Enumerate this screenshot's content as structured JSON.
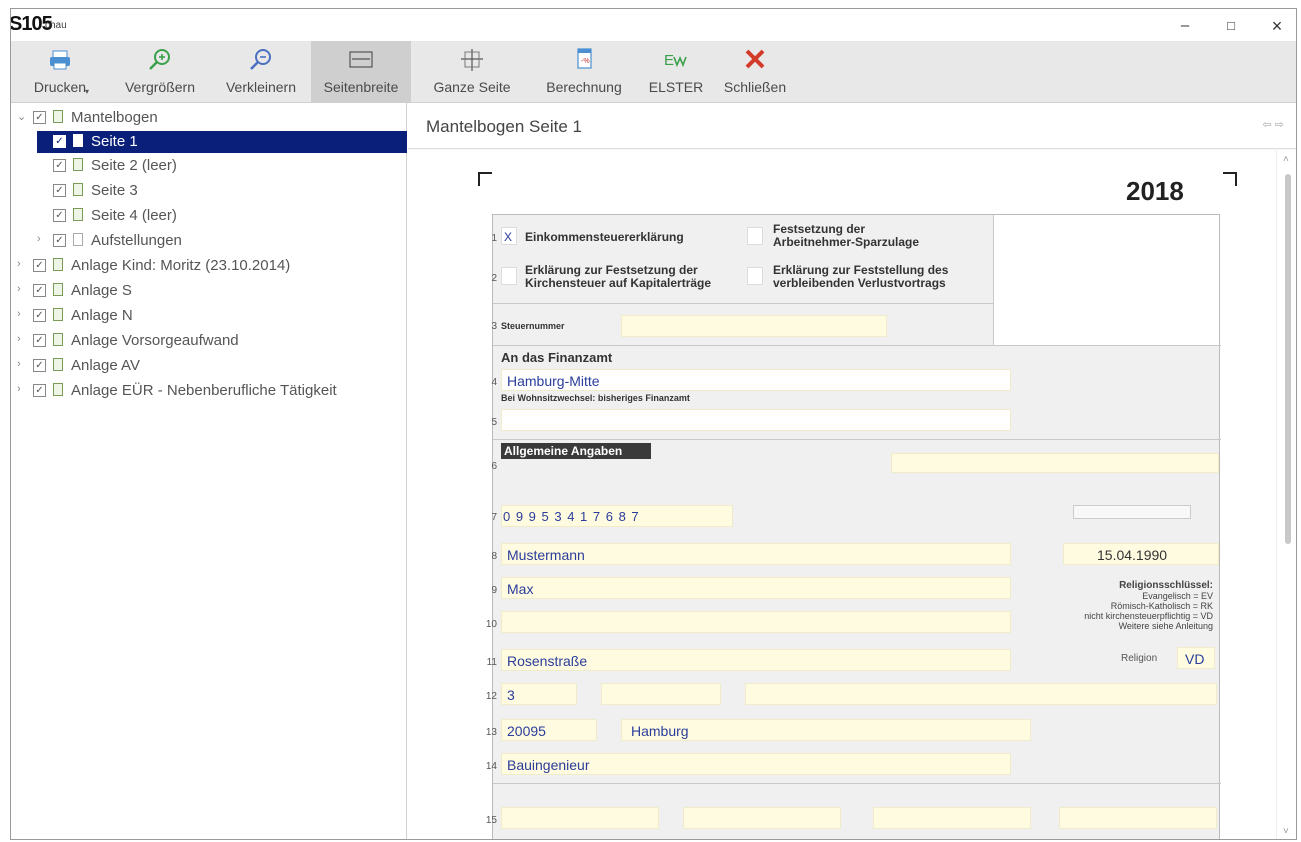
{
  "window": {
    "badge": "S105",
    "title": "chau",
    "minimize": "–",
    "maximize": "□",
    "close": "×"
  },
  "toolbar": {
    "items": [
      {
        "label": "Drucken",
        "icon": "printer-icon"
      },
      {
        "label": "Vergrößern",
        "icon": "zoom-in-icon"
      },
      {
        "label": "Verkleinern",
        "icon": "zoom-out-icon"
      },
      {
        "label": "Seitenbreite",
        "icon": "page-width-icon"
      },
      {
        "label": "Ganze Seite",
        "icon": "whole-page-icon"
      },
      {
        "label": "Berechnung",
        "icon": "calculation-icon"
      },
      {
        "label": "ELSTER",
        "icon": "elster-icon"
      },
      {
        "label": "Schließen",
        "icon": "close-x-icon"
      }
    ],
    "active": "Seitenbreite"
  },
  "tree": {
    "items": [
      {
        "label": "Mantelbogen",
        "expanded": true,
        "level": 0
      },
      {
        "label": "Seite 1",
        "selected": true,
        "level": 1
      },
      {
        "label": "Seite 2 (leer)",
        "level": 1
      },
      {
        "label": "Seite 3",
        "level": 1
      },
      {
        "label": "Seite 4 (leer)",
        "level": 1
      },
      {
        "label": "Aufstellungen",
        "level": 1
      },
      {
        "label": "Anlage Kind: Moritz (23.10.2014)",
        "level": 0
      },
      {
        "label": "Anlage S",
        "level": 0
      },
      {
        "label": "Anlage N",
        "level": 0
      },
      {
        "label": "Anlage Vorsorgeaufwand",
        "level": 0
      },
      {
        "label": "Anlage AV",
        "level": 0
      },
      {
        "label": "Anlage EÜR - Nebenberufliche Tätigkeit",
        "level": 0
      }
    ]
  },
  "main": {
    "title": "Mantelbogen Seite 1",
    "nav_arrows": "⇦ ⇨"
  },
  "form": {
    "year": "2018",
    "line1_check": "X",
    "opt_einkommen": "Einkommensteuererklärung",
    "opt_festsetzung_1": "Festsetzung der",
    "opt_festsetzung_2": "Arbeitnehmer-Sparzulage",
    "opt_kirche_1": "Erklärung zur Festsetzung der",
    "opt_kirche_2": "Kirchensteuer auf Kapitalerträge",
    "opt_verlust_1": "Erklärung zur Feststellung des",
    "opt_verlust_2": "verbleibenden Verlustvortrags",
    "steuernummer_label": "Steuernummer",
    "finanzamt_heading": "An das Finanzamt",
    "finanzamt_value": "Hamburg-Mitte",
    "wohnsitz_label": "Bei Wohnsitzwechsel: bisheriges Finanzamt",
    "allgemeine_angaben": "Allgemeine Angaben",
    "idnr_value": "0 9 9 5 3 4 1 7 6 8 7",
    "name_value": "Mustermann",
    "geburtsdatum_value": "15.04.1990",
    "vorname_value": "Max",
    "strasse_value": "Rosenstraße",
    "hausnummer_value": "3",
    "plz_value": "20095",
    "ort_value": "Hamburg",
    "beruf_value": "Bauingenieur",
    "religion_label": "Religion",
    "religion_value": "VD",
    "religion_key_title": "Religionsschlüssel:",
    "religion_key_1": "Evangelisch = EV",
    "religion_key_2": "Römisch-Katholisch = RK",
    "religion_key_3": "nicht kirchensteuerpflichtig = VD",
    "religion_key_4": "Weitere siehe Anleitung",
    "line_numbers": [
      "1",
      "2",
      "3",
      "4",
      "5",
      "6",
      "7",
      "8",
      "9",
      "10",
      "11",
      "12",
      "13",
      "14",
      "15"
    ]
  }
}
